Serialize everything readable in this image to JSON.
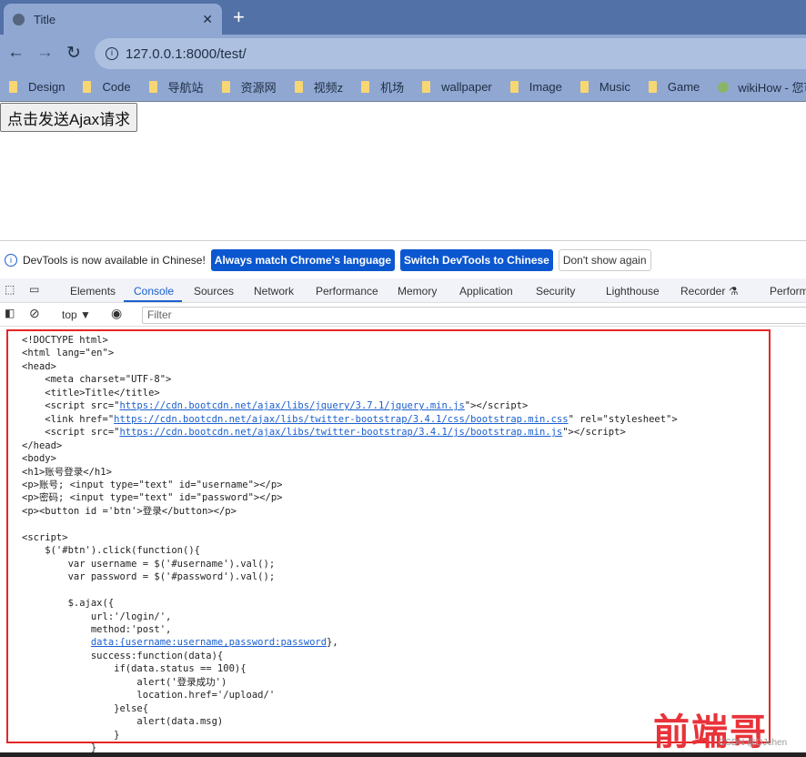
{
  "browser": {
    "tab_title": "Title",
    "url": "127.0.0.1:8000/test/",
    "bookmarks": [
      "Design",
      "Code",
      "导航站",
      "资源网",
      "视频z",
      "机场",
      "wallpaper",
      "Image",
      "Music",
      "Game"
    ],
    "bookmark_wiki": "wikiHow - 您可以"
  },
  "page": {
    "ajax_button": "点击发送Ajax请求"
  },
  "devtools": {
    "infobar": {
      "message": "DevTools is now available in Chinese!",
      "match": "Always match Chrome's language",
      "switch": "Switch DevTools to Chinese",
      "dismiss": "Don't show again"
    },
    "tabs": [
      "Elements",
      "Console",
      "Sources",
      "Network",
      "Performance",
      "Memory",
      "Application",
      "Security",
      "Lighthouse",
      "Recorder ⚗",
      "Perform"
    ],
    "active_tab": "Console",
    "context": "top ▼",
    "filter_placeholder": "Filter"
  },
  "code_lines": [
    [
      {
        "t": "<!DOCTYPE html>"
      }
    ],
    [
      {
        "t": "<html lang=\"en\">"
      }
    ],
    [
      {
        "t": "<head>"
      }
    ],
    [
      {
        "t": "    <meta charset=\"UTF-8\">"
      }
    ],
    [
      {
        "t": "    <title>Title</title>"
      }
    ],
    [
      {
        "t": "    <script src=\""
      },
      {
        "t": "https://cdn.bootcdn.net/ajax/libs/jquery/3.7.1/jquery.min.js",
        "link": true
      },
      {
        "t": "\"></script>"
      }
    ],
    [
      {
        "t": "    <link href=\""
      },
      {
        "t": "https://cdn.bootcdn.net/ajax/libs/twitter-bootstrap/3.4.1/css/bootstrap.min.css",
        "link": true
      },
      {
        "t": "\" rel=\"stylesheet\">"
      }
    ],
    [
      {
        "t": "    <script src=\""
      },
      {
        "t": "https://cdn.bootcdn.net/ajax/libs/twitter-bootstrap/3.4.1/js/bootstrap.min.js",
        "link": true
      },
      {
        "t": "\"></script>"
      }
    ],
    [
      {
        "t": "</head>"
      }
    ],
    [
      {
        "t": "<body>"
      }
    ],
    [
      {
        "t": "<h1>账号登录</h1>"
      }
    ],
    [
      {
        "t": "<p>账号; <input type=\"text\" id=\"username\"></p>"
      }
    ],
    [
      {
        "t": "<p>密码; <input type=\"text\" id=\"password\"></p>"
      }
    ],
    [
      {
        "t": "<p><button id ='btn'>登录</button></p>"
      }
    ],
    [
      {
        "t": " "
      }
    ],
    [
      {
        "t": "<script>"
      }
    ],
    [
      {
        "t": "    $('#btn').click(function(){"
      }
    ],
    [
      {
        "t": "        var username = $('#username').val();"
      }
    ],
    [
      {
        "t": "        var password = $('#password').val();"
      }
    ],
    [
      {
        "t": " "
      }
    ],
    [
      {
        "t": "        $.ajax({"
      }
    ],
    [
      {
        "t": "            url:'/login/',"
      }
    ],
    [
      {
        "t": "            method:'post',"
      }
    ],
    [
      {
        "t": "            "
      },
      {
        "t": "data:{username:username,password:password",
        "link": true
      },
      {
        "t": "},"
      }
    ],
    [
      {
        "t": "            success:function(data){"
      }
    ],
    [
      {
        "t": "                if(data.status == 100){"
      }
    ],
    [
      {
        "t": "                    alert('登录成功')"
      }
    ],
    [
      {
        "t": "                    location.href='/upload/'"
      }
    ],
    [
      {
        "t": "                }else{"
      }
    ],
    [
      {
        "t": "                    alert(data.msg)"
      }
    ],
    [
      {
        "t": "                }"
      }
    ],
    [
      {
        "t": "            }"
      }
    ]
  ],
  "watermark": {
    "logo": "前端哥",
    "credit": "CSDN @DJchen"
  }
}
